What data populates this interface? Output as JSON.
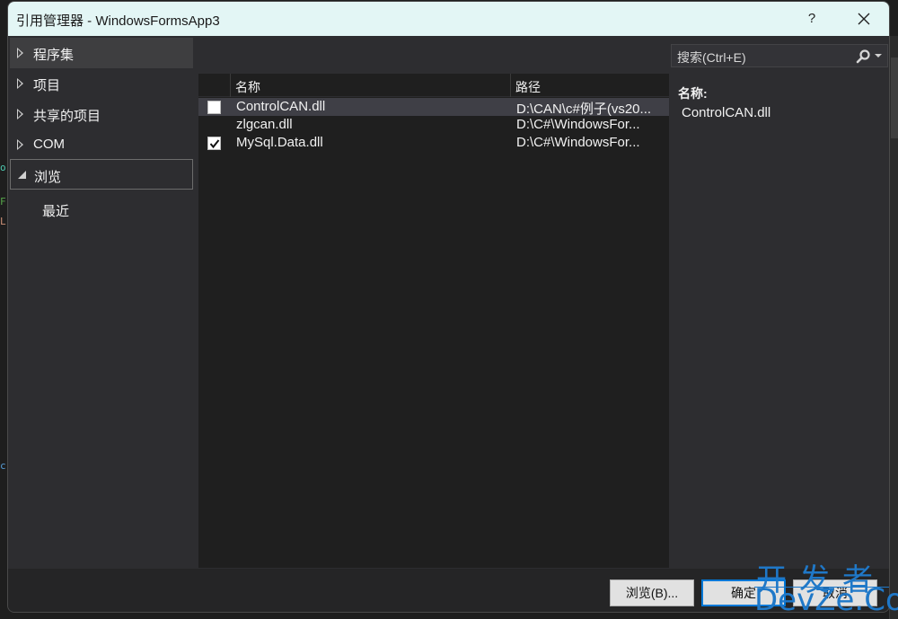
{
  "window": {
    "title": "引用管理器 - WindowsFormsApp3",
    "help_label": "?",
    "close_icon": "close-icon"
  },
  "nav": {
    "items": [
      {
        "label": "程序集",
        "state": "collapsed",
        "hover": true
      },
      {
        "label": "项目",
        "state": "collapsed"
      },
      {
        "label": "共享的项目",
        "state": "collapsed"
      },
      {
        "label": "COM",
        "state": "collapsed"
      },
      {
        "label": "浏览",
        "state": "expanded",
        "selected": true
      }
    ],
    "sub_items": [
      {
        "label": "最近"
      }
    ]
  },
  "search": {
    "placeholder": "搜索(Ctrl+E)",
    "icon": "search-icon"
  },
  "list": {
    "columns": [
      "名称",
      "路径"
    ],
    "rows": [
      {
        "checked": false,
        "name": "ControlCAN.dll",
        "path": "D:\\CAN\\c#例子(vs20...",
        "selected": true,
        "show_checkbox": true
      },
      {
        "checked": false,
        "name": "zlgcan.dll",
        "path": "D:\\C#\\WindowsFor...",
        "selected": false,
        "show_checkbox": false
      },
      {
        "checked": true,
        "name": "MySql.Data.dll",
        "path": "D:\\C#\\WindowsFor...",
        "selected": false,
        "show_checkbox": true
      }
    ]
  },
  "details": {
    "label": "名称:",
    "value": "ControlCAN.dll"
  },
  "footer": {
    "browse_label": "浏览(B)...",
    "ok_label": "确定",
    "cancel_label": "取消"
  },
  "watermark": {
    "top": "开发者",
    "bottom": "DevZe.CoM"
  },
  "colors": {
    "titlebar": "#e3f6f5",
    "dialog_bg": "#2d2d30",
    "list_bg": "#1f1f1f",
    "selected_row": "#3f3f46",
    "primary_border": "#0078d7",
    "watermark": "#1f78c8"
  }
}
